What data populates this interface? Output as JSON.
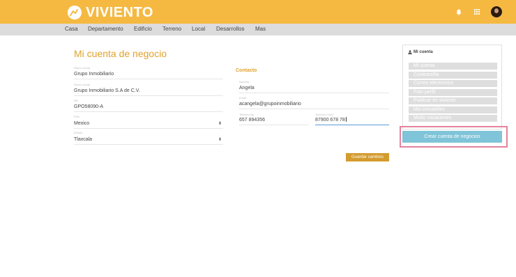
{
  "header": {
    "brand": "VIVIENTO",
    "icons": [
      "bell-icon",
      "grid-icon",
      "avatar"
    ]
  },
  "nav": {
    "items": [
      "Casa",
      "Departamento",
      "Edificio",
      "Terreno",
      "Local",
      "Desarrollos",
      "Mas"
    ]
  },
  "main": {
    "title": "Mi cuenta de negocio",
    "fields": [
      {
        "label": "Razon social",
        "value": "Grupo Inmobiliario"
      },
      {
        "label": "Razon social",
        "value": "Grupo Inmobiliario S.A de C.V."
      },
      {
        "label": "Rfc",
        "value": "GPO58090-A"
      },
      {
        "label": "Pais",
        "value": "Mexico"
      },
      {
        "label": "Estado",
        "value": "Tlaxcala"
      }
    ],
    "contact": {
      "title": "Contacto",
      "name": {
        "label": "Nombre",
        "value": "Angela"
      },
      "email": {
        "label": "Email",
        "value": "acangela@grupoinmobiliario"
      },
      "phone": {
        "label": "Telefono fijo",
        "value": "657 894356"
      },
      "mobile": {
        "label": "Telefono movil",
        "value": "87900 678 78"
      }
    },
    "save_label": "Guardar cambios"
  },
  "sidebar": {
    "title": "Mi cuenta",
    "items": [
      "Mi cuenta",
      "Contraseña",
      "Correo electronico",
      "Foto perfil",
      "Publicar en viviento",
      "Mis inmuebles",
      "Modo vacaciones"
    ],
    "create_label": "Crear cuenta de negocios"
  },
  "colors": {
    "brand": "#f5b942",
    "accent": "#e0a22b",
    "button_blue": "#7fc4d8",
    "highlight": "#e4829c"
  }
}
